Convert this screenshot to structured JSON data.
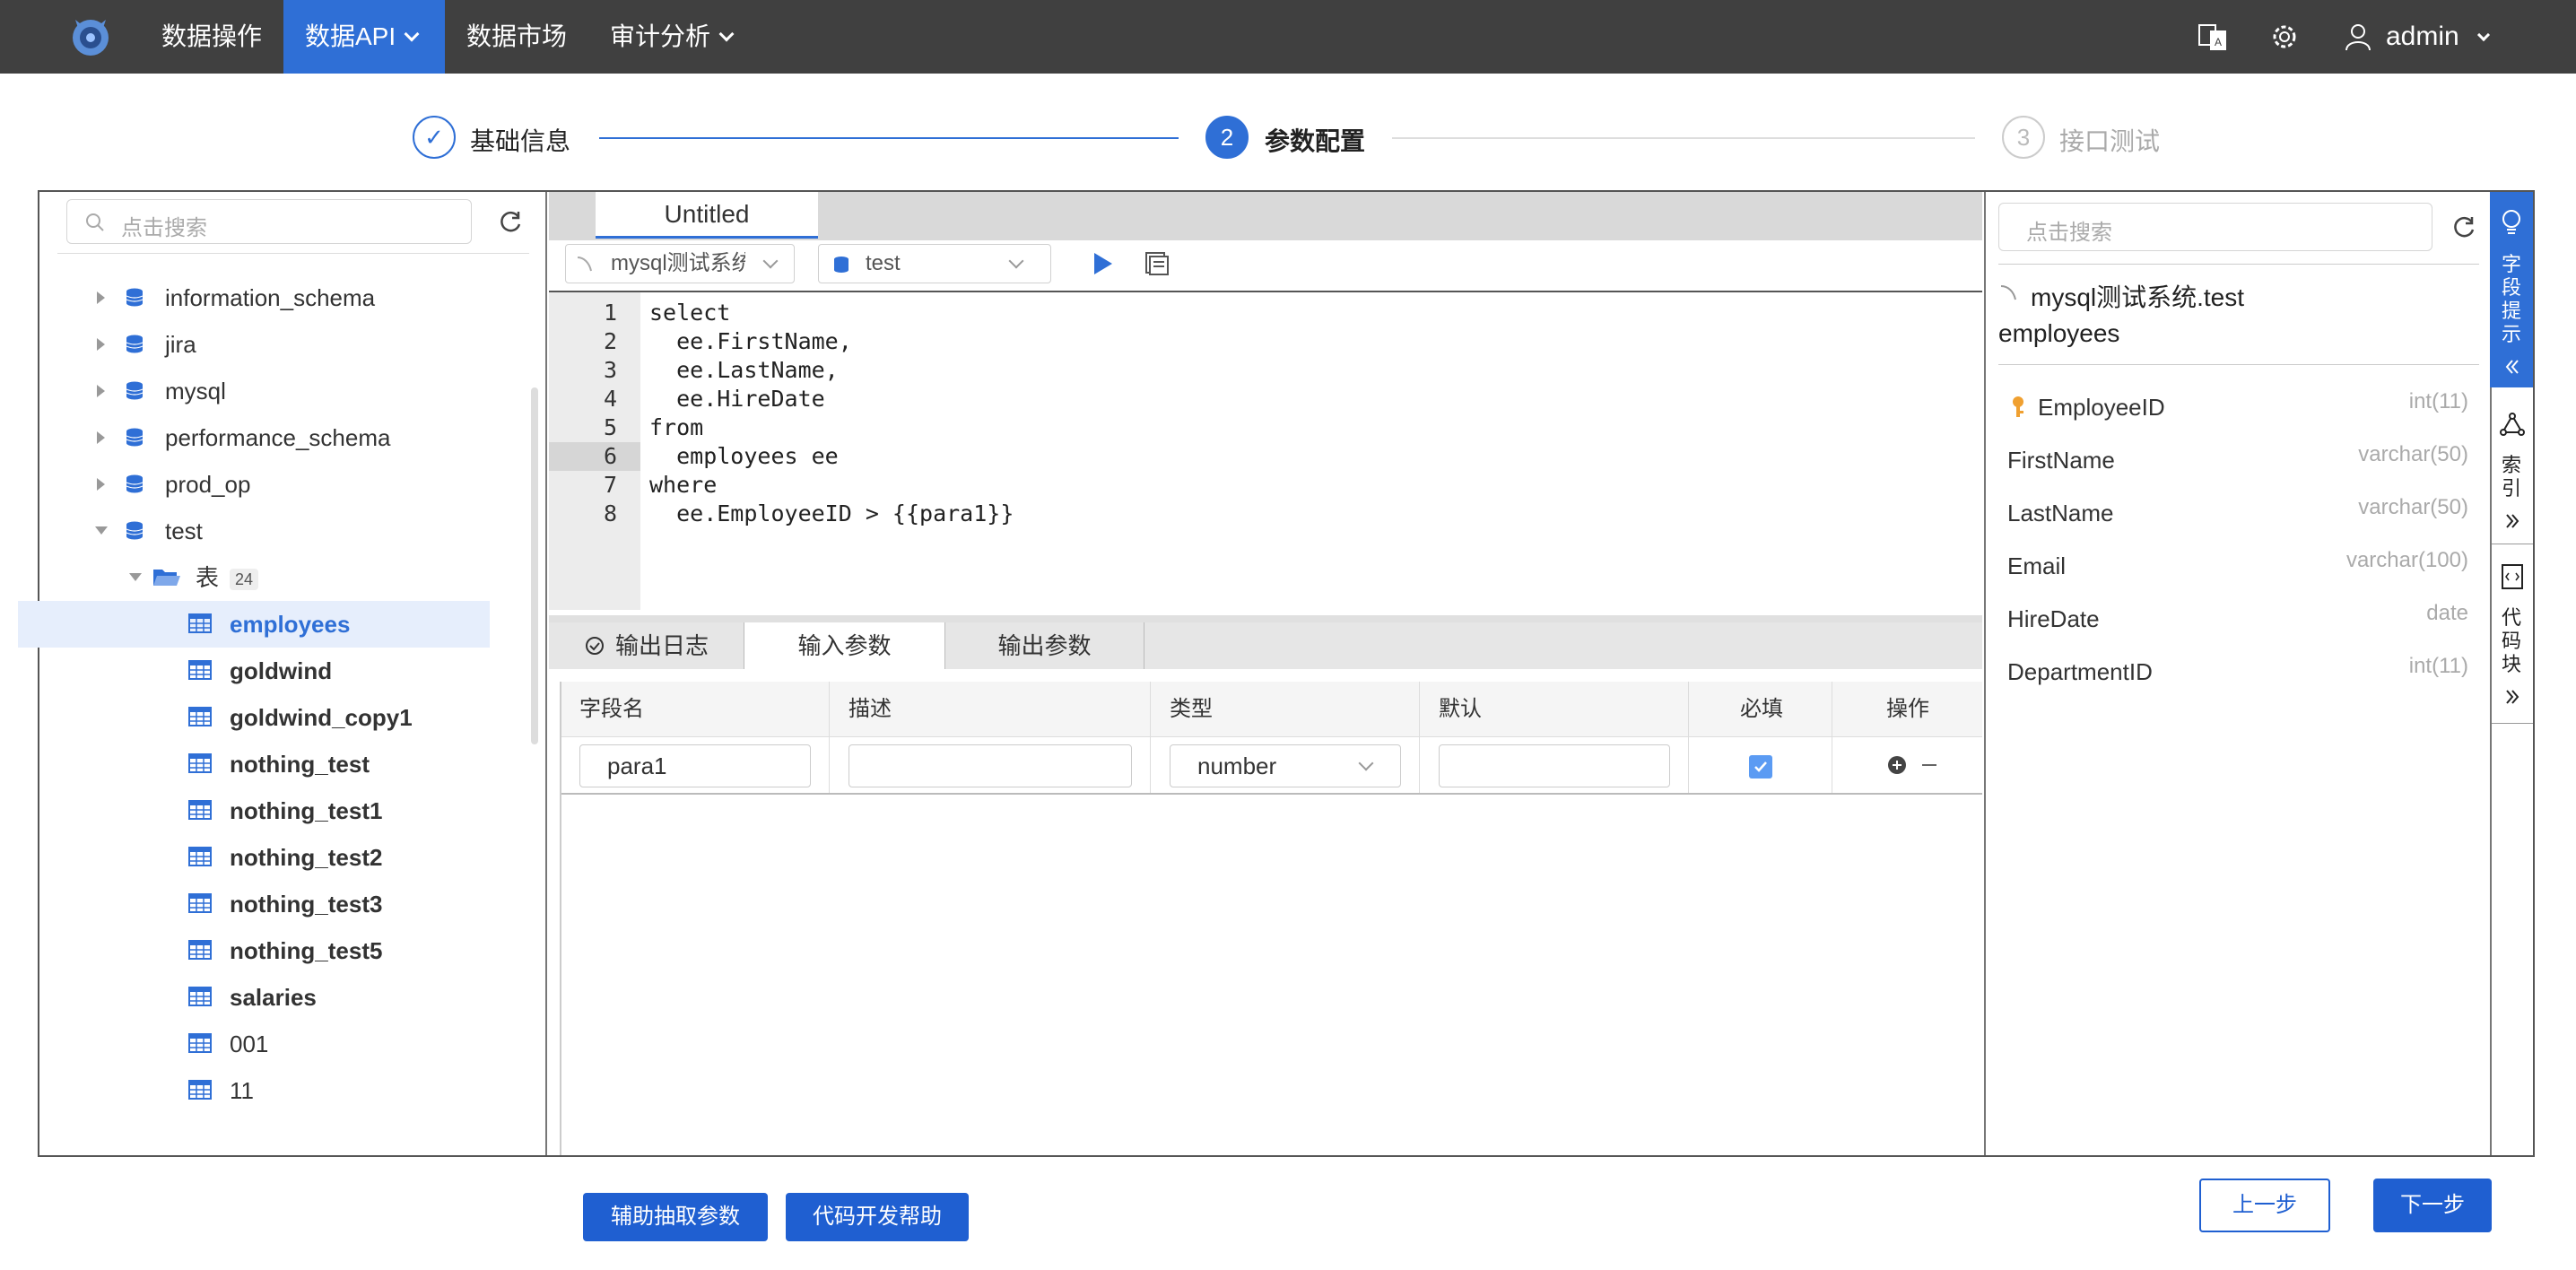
{
  "nav": {
    "items": [
      {
        "label": "数据操作",
        "active": false
      },
      {
        "label": "数据API",
        "active": true
      },
      {
        "label": "数据市场",
        "active": false
      },
      {
        "label": "审计分析",
        "active": false
      }
    ],
    "user": "admin"
  },
  "steps": [
    {
      "num": "✓",
      "label": "基础信息",
      "state": "done"
    },
    {
      "num": "2",
      "label": "参数配置",
      "state": "active"
    },
    {
      "num": "3",
      "label": "接口测试",
      "state": "pending"
    }
  ],
  "left": {
    "search_placeholder": "点击搜索",
    "databases": [
      "information_schema",
      "jira",
      "mysql",
      "performance_schema",
      "prod_op",
      "test"
    ],
    "table_folder": {
      "label": "表",
      "count": "24"
    },
    "tables": [
      "employees",
      "goldwind",
      "goldwind_copy1",
      "nothing_test",
      "nothing_test1",
      "nothing_test2",
      "nothing_test3",
      "nothing_test5",
      "salaries",
      "001",
      "11"
    ],
    "selected_table": "employees"
  },
  "editor": {
    "tab": "Untitled",
    "datasource": "mysql测试系统",
    "database": "test",
    "lines": [
      {
        "n": "1",
        "code": "select",
        "kw": true
      },
      {
        "n": "2",
        "code": "  ee.FirstName,"
      },
      {
        "n": "3",
        "code": "  ee.LastName,"
      },
      {
        "n": "4",
        "code": "  ee.HireDate"
      },
      {
        "n": "5",
        "code": "from",
        "kw": true
      },
      {
        "n": "6",
        "code": "  employees ee"
      },
      {
        "n": "7",
        "code": "where",
        "kw": true
      },
      {
        "n": "8",
        "code": "  ee.EmployeeID > {{para1}}"
      }
    ]
  },
  "bottom": {
    "tabs": [
      "输出日志",
      "输入参数",
      "输出参数"
    ],
    "active_tab": "输入参数",
    "columns": [
      "字段名",
      "描述",
      "类型",
      "默认",
      "必填",
      "操作"
    ],
    "row": {
      "field": "para1",
      "desc": "",
      "type": "number",
      "default": "",
      "required": true
    }
  },
  "right": {
    "search_placeholder": "点击搜索",
    "source": "mysql测试系统.test",
    "table": "employees",
    "fields": [
      {
        "name": "EmployeeID",
        "type": "int(11)",
        "key": true
      },
      {
        "name": "FirstName",
        "type": "varchar(50)"
      },
      {
        "name": "LastName",
        "type": "varchar(50)"
      },
      {
        "name": "Email",
        "type": "varchar(100)"
      },
      {
        "name": "HireDate",
        "type": "date"
      },
      {
        "name": "DepartmentID",
        "type": "int(11)"
      }
    ]
  },
  "side_tabs": {
    "hint": "字段提示",
    "index": "索引",
    "code": "代码块"
  },
  "buttons": {
    "extract": "辅助抽取参数",
    "code_help": "代码开发帮助",
    "prev": "上一步",
    "next": "下一步"
  },
  "colors": {
    "accent": "#2f6fd6",
    "nav_bg": "#404040"
  }
}
